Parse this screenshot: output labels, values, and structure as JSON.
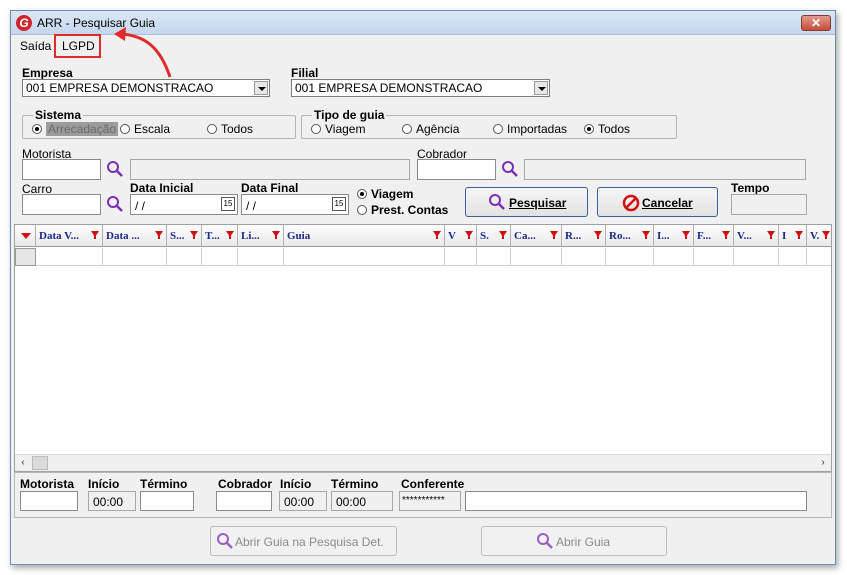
{
  "window": {
    "title": "ARR - Pesquisar Guia",
    "close_glyph": "✕"
  },
  "menu": {
    "saida": "Saída",
    "lgpd": "LGPD"
  },
  "empresa": {
    "label": "Empresa",
    "value": "001 EMPRESA DEMONSTRACAO"
  },
  "filial": {
    "label": "Filial",
    "value": "001 EMPRESA DEMONSTRACAO"
  },
  "sistema": {
    "title": "Sistema",
    "options": [
      "Arrecadação",
      "Escala",
      "Todos"
    ],
    "selected": "Arrecadação"
  },
  "tipo_guia": {
    "title": "Tipo de guia",
    "options": [
      "Viagem",
      "Agência",
      "Importadas",
      "Todos"
    ],
    "selected": "Todos"
  },
  "motorista": {
    "label": "Motorista"
  },
  "cobrador": {
    "label": "Cobrador"
  },
  "carro": {
    "label": "Carro"
  },
  "data_inicial": {
    "label": "Data Inicial",
    "value": " / /"
  },
  "data_final": {
    "label": "Data Final",
    "value": " / /"
  },
  "calendar_glyph": "15",
  "modo": {
    "options": [
      "Viagem",
      "Prest. Contas"
    ],
    "selected": "Viagem"
  },
  "buttons": {
    "pesquisar": "Pesquisar",
    "cancelar": "Cancelar",
    "abrir_guia_det": "Abrir Guia na Pesquisa Det.",
    "abrir_guia": "Abrir Guia"
  },
  "tempo": {
    "label": "Tempo"
  },
  "grid": {
    "columns": [
      "Data V...",
      "Data ...",
      "S...",
      "T...",
      "Li...",
      "Guia",
      "V",
      "S.",
      "Ca...",
      "R...",
      "Ro...",
      "I...",
      "F...",
      "V...",
      "I",
      "V."
    ]
  },
  "bottom": {
    "motorista": "Motorista",
    "inicio1": "Início",
    "termino1": "Término",
    "cobrador": "Cobrador",
    "inicio2": "Início",
    "termino2": "Término",
    "conferente": "Conferente",
    "time1": "00:00",
    "time2": "00:00",
    "time3": "00:00",
    "conferente_value": "***********"
  },
  "colors": {
    "accent": "#e02b2b",
    "header_text": "#1a2a8a",
    "filter": "#d01010",
    "search_icon": "#7a2fb5"
  }
}
